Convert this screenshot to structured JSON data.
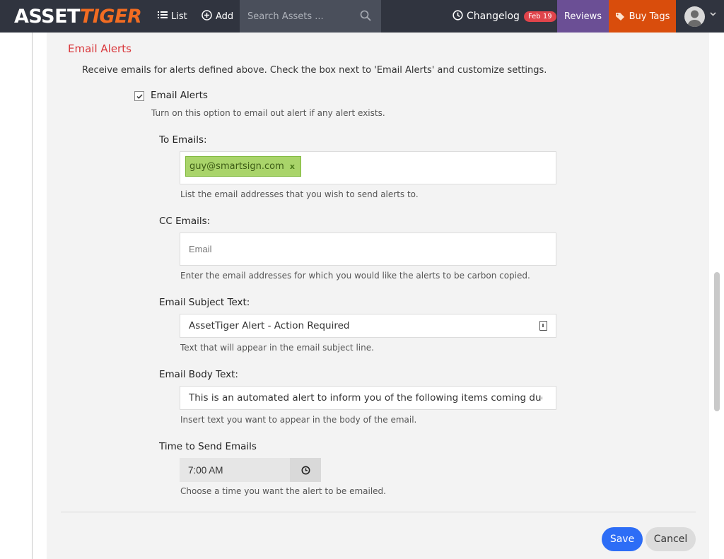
{
  "nav": {
    "logo_left": "ASSET",
    "logo_right": "TIGER",
    "list_label": "List",
    "add_label": "Add",
    "search_placeholder": "Search Assets ...",
    "changelog_label": "Changelog",
    "changelog_badge": "Feb 19",
    "reviews_label": "Reviews",
    "buy_tags_label": "Buy Tags",
    "colors": {
      "bar": "#30343f",
      "reviews": "#6b4f95",
      "buy_tags": "#d94d0c",
      "badge": "#e0444b"
    }
  },
  "section": {
    "title": "Email Alerts",
    "description": "Receive emails for alerts defined above. Check the box next to 'Email Alerts' and customize settings.",
    "checkbox_label": "Email Alerts",
    "checkbox_checked": true,
    "checkbox_help": "Turn on this option to email out alert if any alert exists."
  },
  "fields": {
    "to_emails": {
      "label": "To Emails:",
      "tags": [
        "guy@smartsign.com"
      ],
      "tag_remove": "x",
      "help": "List the email addresses that you wish to send alerts to."
    },
    "cc_emails": {
      "label": "CC Emails:",
      "placeholder": "Email",
      "help": "Enter the email addresses for which you would like the alerts to be carbon copied."
    },
    "subject": {
      "label": "Email Subject Text:",
      "value": "AssetTiger Alert - Action Required",
      "help": "Text that will appear in the email subject line."
    },
    "body": {
      "label": "Email Body Text:",
      "value": "This is an automated alert to inform you of the following items coming due:",
      "help": "Insert text you want to appear in the body of the email."
    },
    "time": {
      "label": "Time to Send Emails",
      "value": "7:00 AM",
      "help": "Choose a time you want the alert to be emailed."
    }
  },
  "actions": {
    "save_label": "Save",
    "cancel_label": "Cancel",
    "save_color": "#2d6df6"
  }
}
